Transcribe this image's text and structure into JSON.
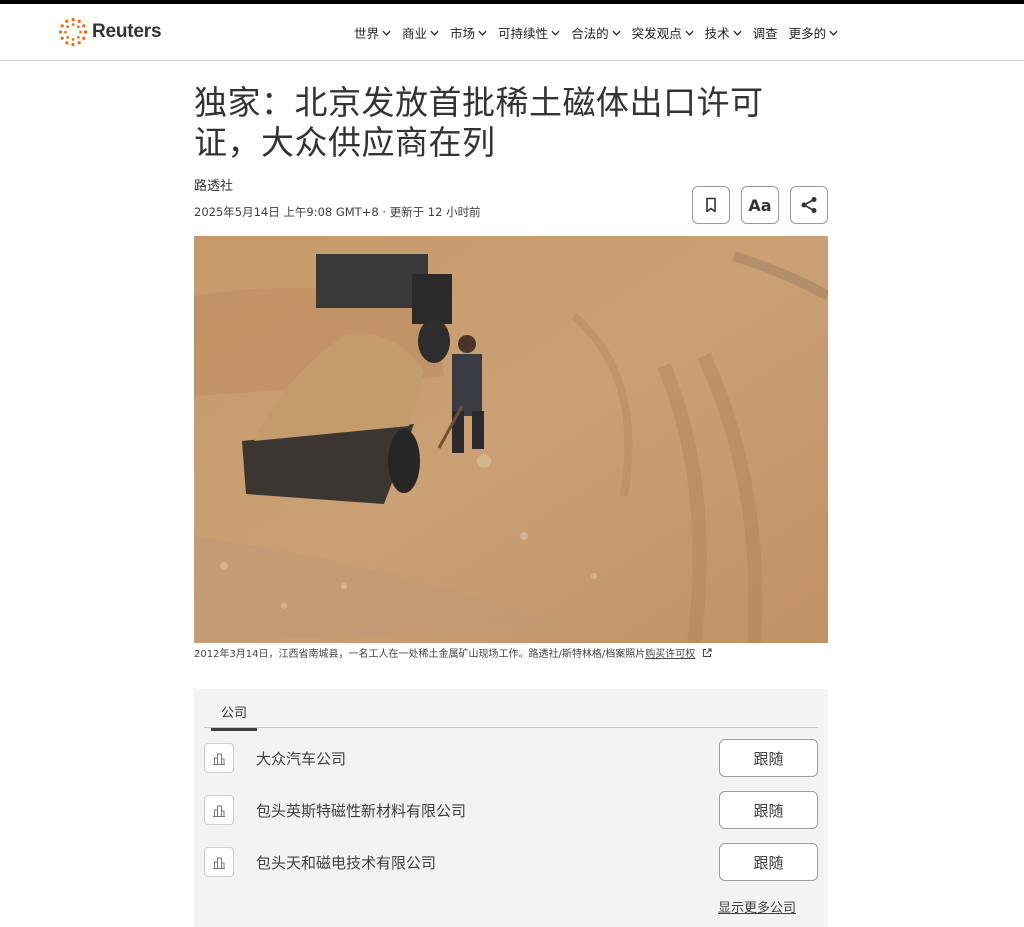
{
  "site": {
    "logo_text": "Reuters",
    "brand_color": "#fa6400"
  },
  "nav": {
    "items": [
      {
        "label": "世界"
      },
      {
        "label": "商业"
      },
      {
        "label": "市场"
      },
      {
        "label": "可持续性"
      },
      {
        "label": "合法的"
      },
      {
        "label": "突发观点"
      },
      {
        "label": "技术"
      },
      {
        "label": "调查"
      },
      {
        "label": "更多的"
      }
    ]
  },
  "article": {
    "title": "独家：北京发放首批稀土磁体出口许可证，大众供应商在列",
    "byline": "路透社",
    "date": "2025年5月14日 上午9:08 GMT+8 · 更新于 12 小时前",
    "tools": {
      "bookmark_icon": "bookmark-icon",
      "text_size_label": "Aa",
      "share_icon": "share-icon"
    },
    "caption": "2012年3月14日，江西省南城县，一名工人在一处稀土金属矿山现场工作。路透社/斯特林格/档案照片",
    "caption_link": "购买许可权"
  },
  "companies": {
    "tab_label": "公司",
    "items": [
      {
        "name": "大众汽车公司",
        "follow_label": "跟随"
      },
      {
        "name": "包头英斯特磁性新材料有限公司",
        "follow_label": "跟随"
      },
      {
        "name": "包头天和磁电技术有限公司",
        "follow_label": "跟随"
      }
    ],
    "show_more_label": "显示更多公司"
  }
}
